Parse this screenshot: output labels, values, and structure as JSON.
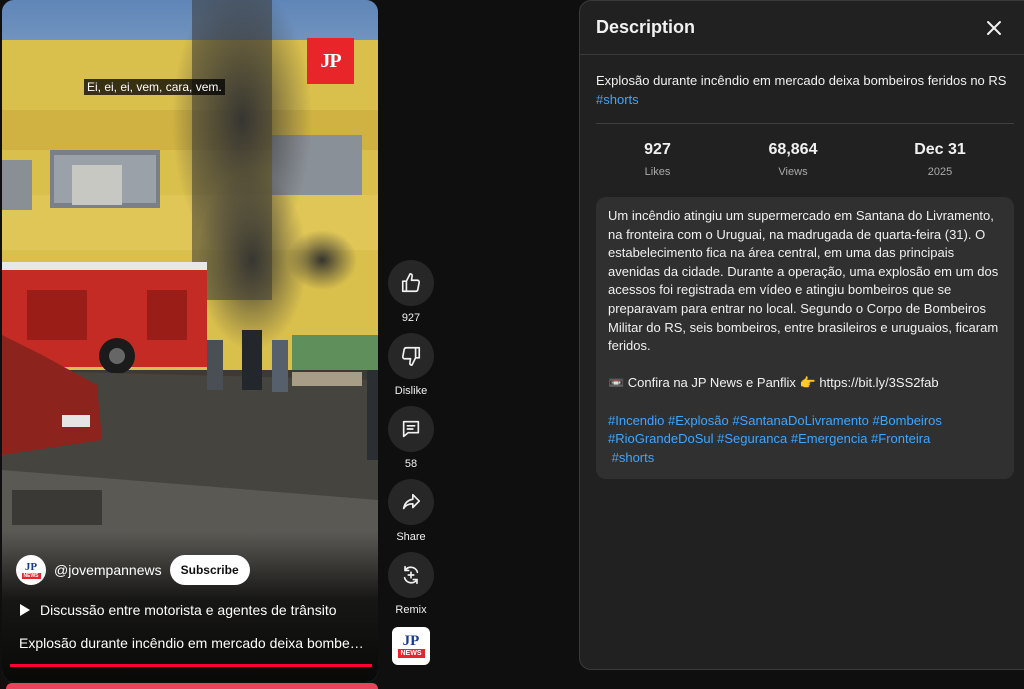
{
  "video": {
    "caption": "Ei, ei, ei, vem, cara, vem.",
    "watermark": "JP",
    "channel": {
      "avatar_top": "JP",
      "avatar_bottom": "NEWS",
      "handle": "@jovempannews",
      "subscribe_label": "Subscribe"
    },
    "playlist_label": "Discussão entre motorista e agentes de trânsito",
    "title": "Explosão durante incêndio em mercado deixa bombeiros feridos no RS",
    "progress": 1.0
  },
  "actions": {
    "like": {
      "icon": "thumb-up-icon",
      "label": "927"
    },
    "dislike": {
      "icon": "thumb-down-icon",
      "label": "Dislike"
    },
    "comments": {
      "icon": "comment-icon",
      "label": "58"
    },
    "share": {
      "icon": "share-icon",
      "label": "Share"
    },
    "remix": {
      "icon": "remix-icon",
      "label": "Remix"
    },
    "sound_thumb": {
      "top": "JP",
      "bottom": "NEWS"
    }
  },
  "description": {
    "title": "Description",
    "headline": "Explosão durante incêndio em mercado deixa bombeiros feridos no RS",
    "headline_tag": "#shorts",
    "stats": [
      {
        "value": "927",
        "label": "Likes"
      },
      {
        "value": "68,864",
        "label": "Views"
      },
      {
        "value": "Dec 31",
        "label": "2025"
      }
    ],
    "body": "Um incêndio atingiu um supermercado em Santana do Livramento, na fronteira com o Uruguai, na madrugada de quarta-feira (31). O estabelecimento fica na área central, em uma das principais avenidas da cidade. Durante a operação, uma explosão em um dos acessos foi registrada em vídeo e atingiu bombeiros que se preparavam para entrar no local. Segundo o Corpo de Bombeiros Militar do RS, seis bombeiros, entre brasileiros e uruguaios, ficaram feridos.",
    "promo": "📼 Confira na JP News e Panflix 👉 https://bit.ly/3SS2fab",
    "hashtags_line1": "#Incendio #Explosão #SantanaDoLivramento #Bombeiros",
    "hashtags_line2": "#RioGrandeDoSul #Seguranca #Emergencia #Fronteira",
    "hashtags_line3": " #shorts"
  },
  "colors": {
    "background": "#0f0f0f",
    "panel": "#212121",
    "link": "#3ea6ff",
    "progress": "#ff0033",
    "brand_red": "#e8262a"
  }
}
